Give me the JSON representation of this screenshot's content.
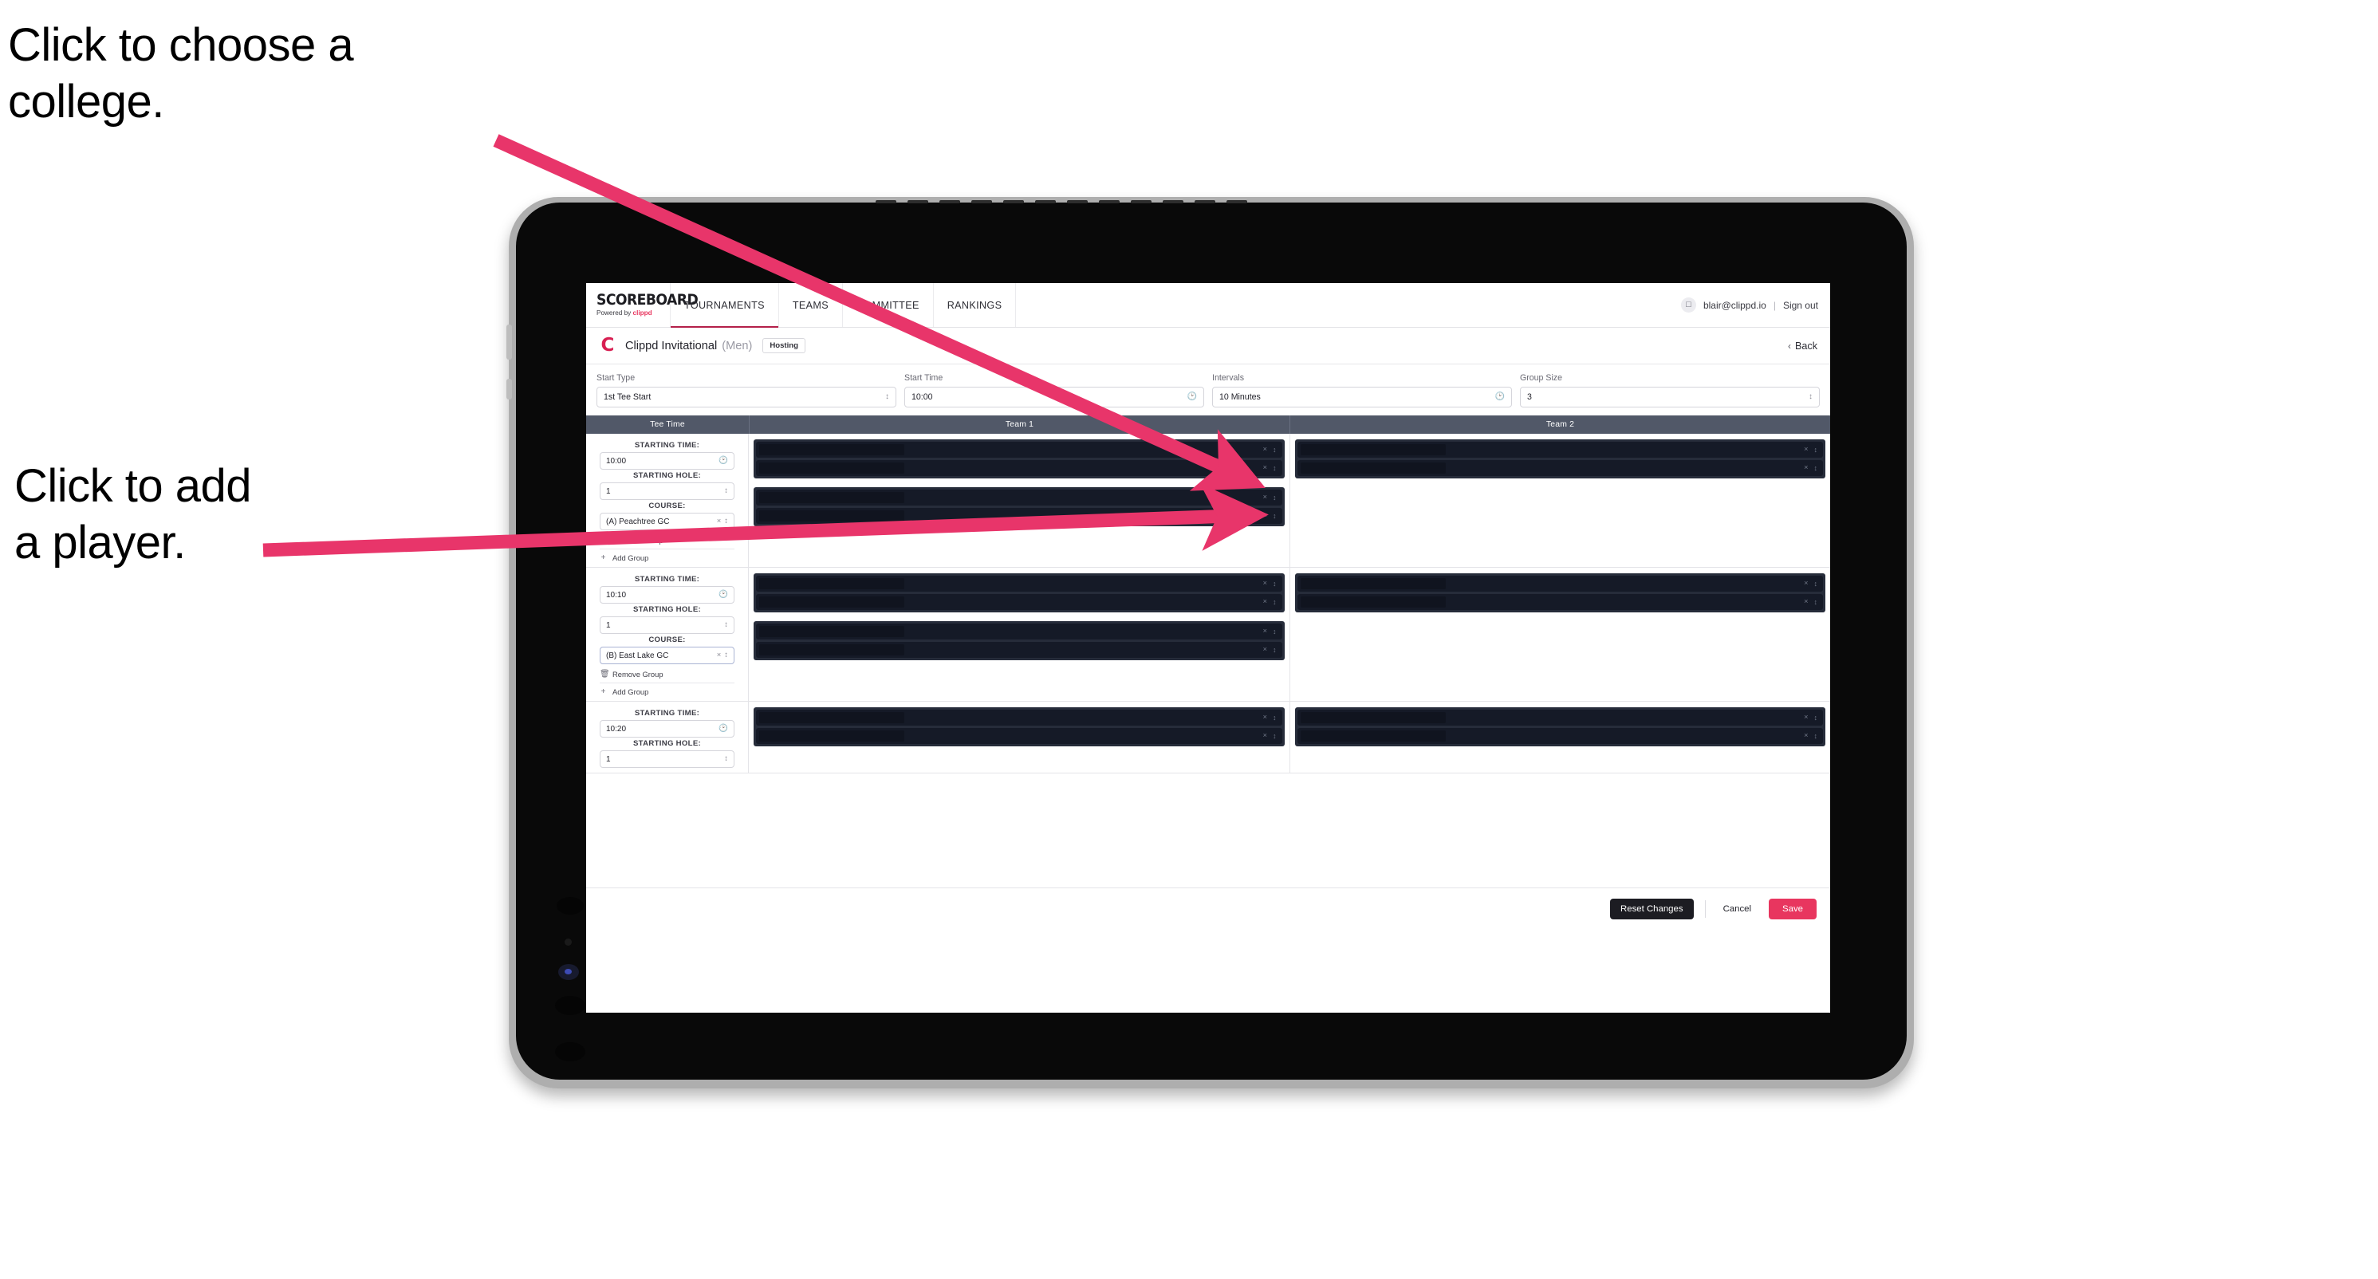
{
  "annotations": {
    "choose_college": "Click to choose a\ncollege.",
    "add_player": "Click to add\na player."
  },
  "colors": {
    "accent_pink": "#e8365f",
    "annotation_arrow": "#e8356a",
    "table_header": "#515868",
    "player_row": "#151a27",
    "nav_active_underline": "#b4204a"
  },
  "nav": {
    "brand_main": "SCOREBOARD",
    "brand_sub_prefix": "Powered by ",
    "brand_sub_accent": "clippd",
    "tabs": [
      {
        "label": "TOURNAMENTS",
        "active": true
      },
      {
        "label": "TEAMS",
        "active": false
      },
      {
        "label": "COMMITTEE",
        "active": false
      },
      {
        "label": "RANKINGS",
        "active": false
      }
    ],
    "avatar_icon": "user-avatar-icon",
    "user_email": "blair@clippd.io",
    "separator": "|",
    "sign_out": "Sign out"
  },
  "tournament_bar": {
    "logo_letter": "C",
    "name": "Clippd Invitational",
    "gender": "(Men)",
    "badge": "Hosting",
    "back_chevron": "‹",
    "back_label": "Back"
  },
  "controls": [
    {
      "label": "Start Type",
      "value": "1st Tee Start",
      "icon": "stepper-icon"
    },
    {
      "label": "Start Time",
      "value": "10:00",
      "icon": "clock-icon"
    },
    {
      "label": "Intervals",
      "value": "10 Minutes",
      "icon": "clock-icon"
    },
    {
      "label": "Group Size",
      "value": "3",
      "icon": "stepper-icon"
    }
  ],
  "table": {
    "headers": {
      "tee_time": "Tee Time",
      "team_1": "Team 1",
      "team_2": "Team 2"
    },
    "field_labels": {
      "starting_time": "STARTING TIME:",
      "starting_hole": "STARTING HOLE:",
      "course": "COURSE:"
    },
    "group_actions": {
      "remove": "Remove Group",
      "add": "Add Group",
      "remove_icon": "trash-icon",
      "add_icon": "plus-icon"
    },
    "rows": [
      {
        "starting_time": "10:00",
        "starting_hole": "1",
        "course": "(A) Peachtree GC",
        "course_focused": false,
        "team1_groups": [
          2,
          2
        ],
        "team2_groups": [
          2
        ]
      },
      {
        "starting_time": "10:10",
        "starting_hole": "1",
        "course": "(B) East Lake GC",
        "course_focused": true,
        "team1_groups": [
          2,
          2
        ],
        "team2_groups": [
          2
        ]
      },
      {
        "starting_time": "10:20",
        "starting_hole": "1",
        "course": "",
        "course_focused": false,
        "team1_groups": [
          2
        ],
        "team2_groups": [
          2
        ]
      }
    ],
    "row_icons": {
      "clear": "×",
      "stepper": "⌃",
      "clear_name": "clear-icon",
      "stepper_name": "stepper-icon"
    }
  },
  "footer": {
    "reset": "Reset Changes",
    "cancel": "Cancel",
    "save": "Save"
  }
}
